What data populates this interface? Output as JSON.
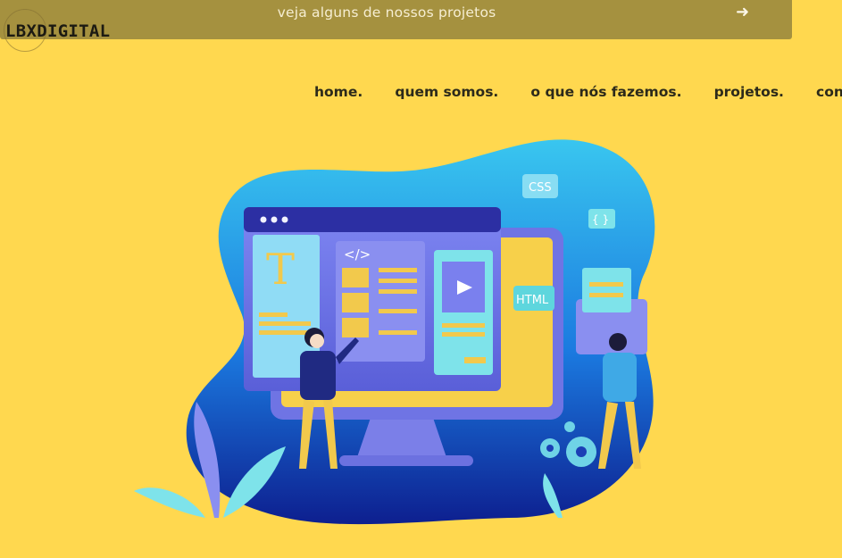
{
  "banner": {
    "text": "veja alguns de nossos projetos",
    "arrow_icon": "arrow-right-icon"
  },
  "logo": {
    "text": "LBXDIGITAL"
  },
  "nav": {
    "items": [
      "home.",
      "quem somos.",
      "o que nós fazemos.",
      "projetos.",
      "contato"
    ]
  },
  "illustration": {
    "badges": [
      "CSS",
      "{ }",
      "HTML"
    ],
    "code_tag": "</>",
    "text_glyph": "T"
  },
  "colors": {
    "background": "#ffd84f",
    "banner": "#a5913f",
    "blob": "#1d7fe0",
    "screen": "#6d74e6"
  }
}
